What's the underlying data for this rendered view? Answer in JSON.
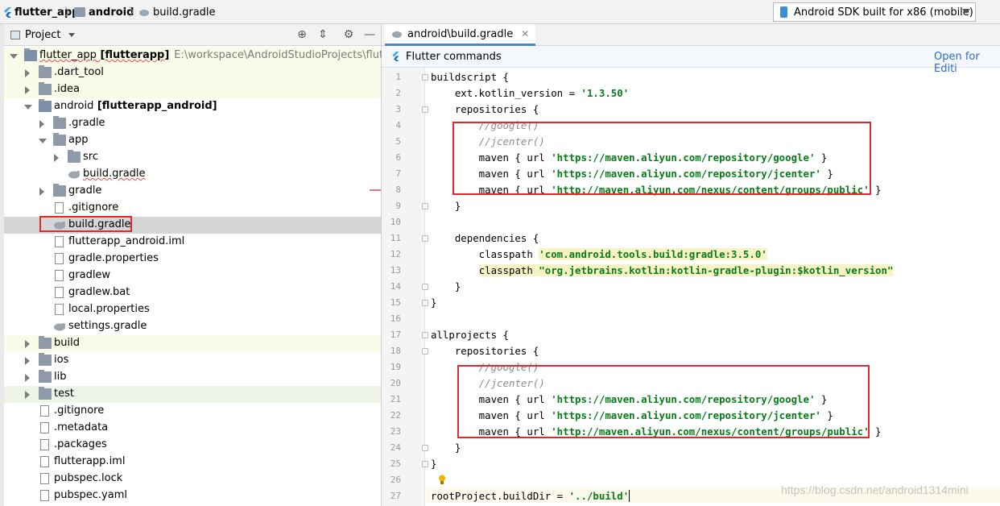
{
  "navbar": {
    "crumbs": [
      "flutter_app",
      "android",
      "build.gradle"
    ],
    "device": "Android SDK built for x86 (mobile)"
  },
  "project_panel": {
    "title": "Project",
    "tree": [
      {
        "label": "flutter_app",
        "module": "[flutterapp]",
        "path": "E:\\workspace\\AndroidStudioProjects\\flutter_ap"
      },
      {
        "label": ".dart_tool"
      },
      {
        "label": ".idea"
      },
      {
        "label": "android",
        "module": "[flutterapp_android]"
      },
      {
        "label": ".gradle"
      },
      {
        "label": "app"
      },
      {
        "label": "src"
      },
      {
        "label": "build.gradle"
      },
      {
        "label": "gradle"
      },
      {
        "label": ".gitignore"
      },
      {
        "label": "build.gradle"
      },
      {
        "label": "flutterapp_android.iml"
      },
      {
        "label": "gradle.properties"
      },
      {
        "label": "gradlew"
      },
      {
        "label": "gradlew.bat"
      },
      {
        "label": "local.properties"
      },
      {
        "label": "settings.gradle"
      },
      {
        "label": "build"
      },
      {
        "label": "ios"
      },
      {
        "label": "lib"
      },
      {
        "label": "test"
      },
      {
        "label": ".gitignore"
      },
      {
        "label": ".metadata"
      },
      {
        "label": ".packages"
      },
      {
        "label": "flutterapp.iml"
      },
      {
        "label": "pubspec.lock"
      },
      {
        "label": "pubspec.yaml"
      }
    ]
  },
  "editor": {
    "tab": "android\\build.gradle",
    "flutter_bar": {
      "label": "Flutter commands",
      "action": "Open for Editi"
    },
    "line_numbers": [
      "1",
      "2",
      "3",
      "4",
      "5",
      "6",
      "7",
      "8",
      "9",
      "10",
      "11",
      "12",
      "13",
      "14",
      "15",
      "16",
      "17",
      "18",
      "19",
      "20",
      "21",
      "22",
      "23",
      "24",
      "25",
      "26",
      "27"
    ],
    "lines": [
      "buildscript {",
      "    ext.kotlin_version = '1.3.50'",
      "    repositories {",
      "        //google()",
      "        //jcenter()",
      "        maven { url 'https://maven.aliyun.com/repository/google' }",
      "        maven { url 'https://maven.aliyun.com/repository/jcenter' }",
      "        maven { url 'http://maven.aliyun.com/nexus/content/groups/public' }",
      "    }",
      "",
      "    dependencies {",
      "        classpath 'com.android.tools.build:gradle:3.5.0'",
      "        classpath \"org.jetbrains.kotlin:kotlin-gradle-plugin:$kotlin_version\"",
      "    }",
      "}",
      "",
      "allprojects {",
      "    repositories {",
      "        //google()",
      "        //jcenter()",
      "        maven { url 'https://maven.aliyun.com/repository/google' }",
      "        maven { url 'https://maven.aliyun.com/repository/jcenter' }",
      "        maven { url 'http://maven.aliyun.com/nexus/content/groups/public' }",
      "    }",
      "}",
      "",
      "rootProject.buildDir = '../build'"
    ]
  },
  "watermark": "https://blog.csdn.net/android1314mini",
  "colors": {
    "string": "#067d17",
    "comment": "#8c8c8c",
    "highlight": "#f8f3c6",
    "annotation_box": "#e0282d",
    "link": "#2a6ec1"
  }
}
